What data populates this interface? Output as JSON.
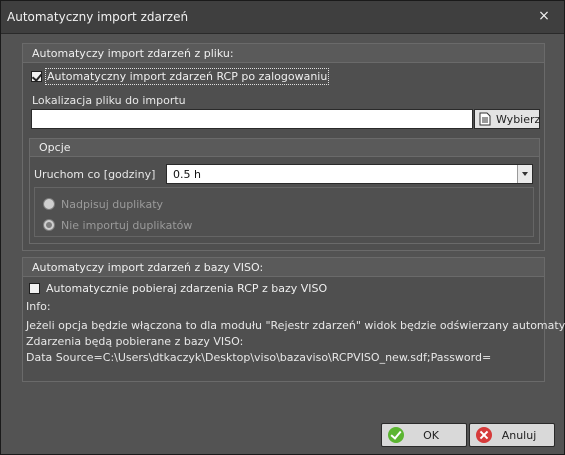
{
  "window": {
    "title": "Automatyczny import zdarzeń",
    "close_glyph": "×"
  },
  "file_section": {
    "title": "Automatyczy import zdarzeń z pliku:",
    "auto_import_label": "Automatyczny import zdarzeń RCP po zalogowaniu",
    "auto_import_checked": true,
    "location_label": "Lokalizacja pliku do importu",
    "location_value": "",
    "choose_label": "Wybierz",
    "options": {
      "title": "Opcje",
      "run_every_label": "Uruchom co [godziny]",
      "run_every_value": "0.5 h",
      "radio_overwrite_label": "Nadpisuj duplikaty",
      "radio_no_import_label": "Nie importuj duplikatów"
    }
  },
  "viso_section": {
    "title": "Automatyczy import zdarzeń z bazy VISO:",
    "fetch_label": "Automatycznie pobieraj zdarzenia RCP z bazy VISO",
    "fetch_checked": false,
    "info_title": "Info:",
    "info_line1": "Jeżeli opcja będzie włączona to dla modułu \"Rejestr zdarzeń\" widok będzie odświerzany automatyczne",
    "info_line2": "Zdarzenia będą pobierane z bazy VISO:",
    "info_line3": "Data Source=C:\\Users\\dtkaczyk\\Desktop\\viso\\bazaviso\\RCPVISO_new.sdf;Password="
  },
  "footer": {
    "ok_label": "OK",
    "cancel_label": "Anuluj"
  }
}
